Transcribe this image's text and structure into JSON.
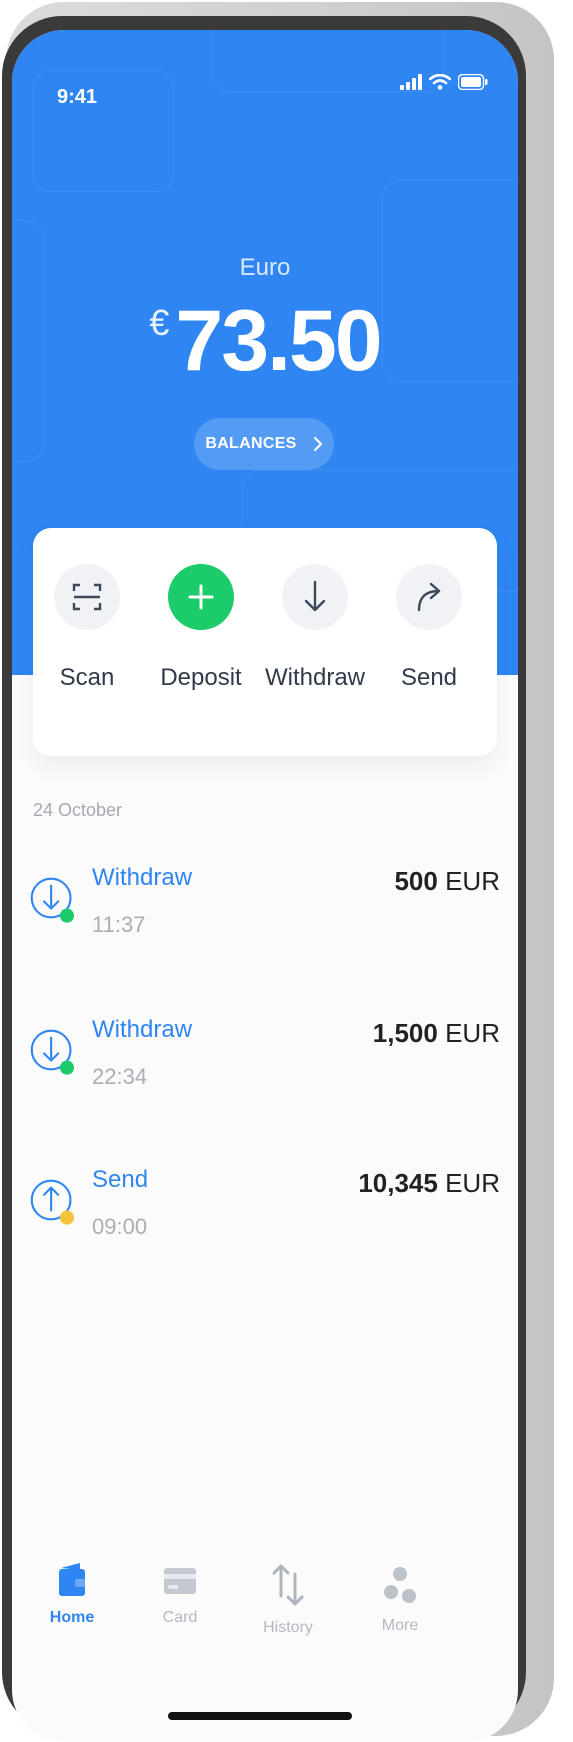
{
  "status_bar": {
    "time": "9:41"
  },
  "balance": {
    "currency_name": "Euro",
    "symbol": "€",
    "amount": "73.50"
  },
  "balances_button": {
    "label": "BALANCES"
  },
  "actions": [
    {
      "label": "Scan",
      "icon": "scan-icon"
    },
    {
      "label": "Deposit",
      "icon": "plus-icon"
    },
    {
      "label": "Withdraw",
      "icon": "arrow-down-icon"
    },
    {
      "label": "Send",
      "icon": "share-arrow-icon"
    }
  ],
  "transactions": {
    "date": "24 October",
    "items": [
      {
        "title": "Withdraw",
        "time": "11:37",
        "amount": "500",
        "currency": "EUR",
        "status_color": "#1ccb6a",
        "icon": "arrow-down-circle-icon"
      },
      {
        "title": "Withdraw",
        "time": "22:34",
        "amount": "1,500",
        "currency": "EUR",
        "status_color": "#1ccb6a",
        "icon": "arrow-down-circle-icon"
      },
      {
        "title": "Send",
        "time": "09:00",
        "amount": "10,345",
        "currency": "EUR",
        "status_color": "#f5c23c",
        "icon": "arrow-up-circle-icon"
      }
    ]
  },
  "tabs": [
    {
      "label": "Home",
      "icon": "wallet-icon",
      "active": true
    },
    {
      "label": "Card",
      "icon": "card-icon",
      "active": false
    },
    {
      "label": "History",
      "icon": "swap-arrows-icon",
      "active": false
    },
    {
      "label": "More",
      "icon": "dots-icon",
      "active": false
    }
  ],
  "colors": {
    "accent": "#2f86f2",
    "deposit": "#1ccb6a",
    "pending": "#f5c23c"
  }
}
